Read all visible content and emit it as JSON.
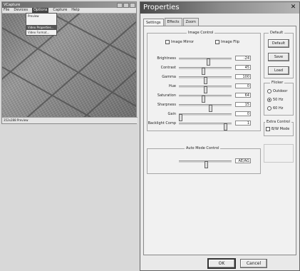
{
  "left_window": {
    "title": "VCapture",
    "menu": [
      "File",
      "Devices",
      "Options",
      "Capture",
      "Help"
    ],
    "active_menu_index": 2,
    "dropdown_items": [
      "Preview",
      "Video Properties...",
      "Video Format..."
    ],
    "status": "352x288 Preview"
  },
  "props": {
    "title": "Properties",
    "close_glyph": "✕",
    "tabs": [
      "Settings",
      "Effects",
      "Zoom"
    ],
    "image_control": {
      "label": "Image Control",
      "mirror": "Image Mirror",
      "flip": "Image Flip",
      "sliders": [
        {
          "label": "Brightness",
          "value": "-24",
          "pct": 0.55
        },
        {
          "label": "Contrast",
          "value": "45",
          "pct": 0.45
        },
        {
          "label": "Gamma",
          "value": "100",
          "pct": 0.5
        },
        {
          "label": "Hue",
          "value": "0",
          "pct": 0.5
        },
        {
          "label": "Saturation",
          "value": "64",
          "pct": 0.45
        },
        {
          "label": "Sharpness",
          "value": "15",
          "pct": 0.6
        },
        {
          "label": "Gain",
          "value": "0",
          "pct": 0.0
        },
        {
          "label": "Backlight Comp",
          "value": "1",
          "pct": 0.9
        }
      ]
    },
    "default_group": {
      "label": "Default",
      "buttons": [
        "Default",
        "Save",
        "Load"
      ]
    },
    "flicker": {
      "label": "Flicker",
      "options": [
        "Outdoor",
        "50 Hz",
        "60 Hz"
      ],
      "selected": 1
    },
    "extra": {
      "label": "Extra Control",
      "bw": "B/W Mode"
    },
    "auto_mode": {
      "label": "Auto Mode Control",
      "value": "AE/AG"
    },
    "ok": "OK",
    "cancel": "Cancel"
  }
}
